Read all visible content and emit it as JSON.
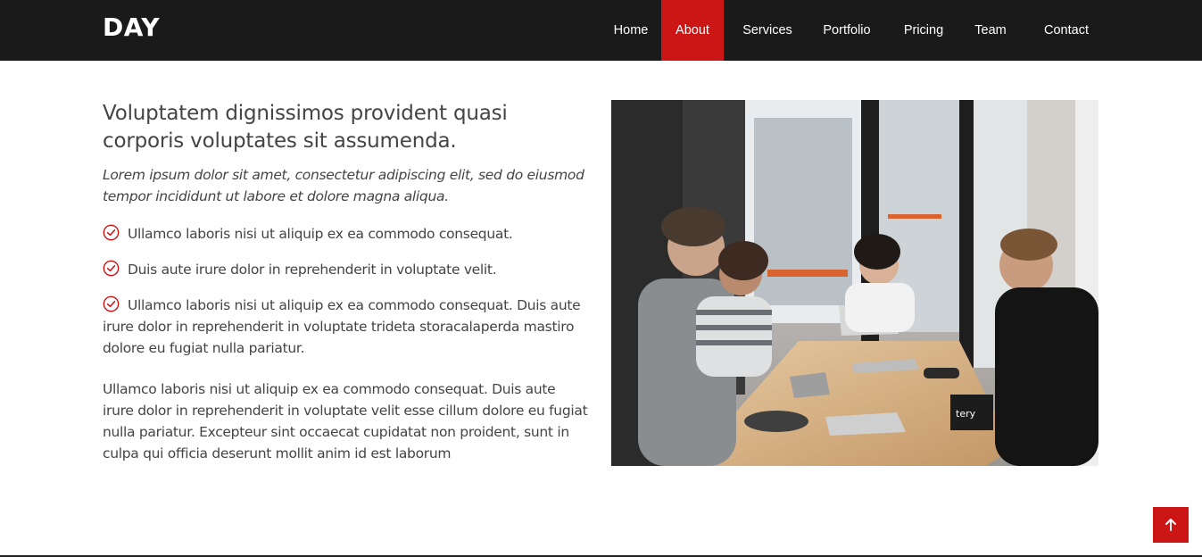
{
  "brand": {
    "logo": "DAY"
  },
  "nav": {
    "items": [
      {
        "label": "Home",
        "active": false
      },
      {
        "label": "About",
        "active": true
      },
      {
        "label": "Services",
        "active": false
      },
      {
        "label": "Portfolio",
        "active": false
      },
      {
        "label": "Pricing",
        "active": false
      },
      {
        "label": "Team",
        "active": false
      },
      {
        "label": "Contact",
        "active": false
      }
    ]
  },
  "about": {
    "headline": "Voluptatem dignissimos provident quasi corporis voluptates sit assumenda.",
    "intro": "Lorem ipsum dolor sit amet, consectetur adipiscing elit, sed do eiusmod tempor incididunt ut labore et dolore magna aliqua.",
    "checklist": [
      "Ullamco laboris nisi ut aliquip ex ea commodo consequat.",
      "Duis aute irure dolor in reprehenderit in voluptate velit.",
      "Ullamco laboris nisi ut aliquip ex ea commodo consequat. Duis aute irure dolor in reprehenderit in voluptate trideta storacalaperda mastiro dolore eu fugiat nulla pariatur."
    ],
    "paragraph": "Ullamco laboris nisi ut aliquip ex ea commodo consequat. Duis aute irure dolor in reprehenderit in voluptate velit esse cillum dolore eu fugiat nulla pariatur. Excepteur sint occaecat cupidatat non proident, sunt in culpa qui officia deserunt mollit anim id est laborum",
    "photo_text": "tery"
  },
  "icons": {
    "check": "check-circle-icon",
    "back_to_top": "arrow-up-icon"
  },
  "colors": {
    "accent": "#cc1616",
    "header_bg": "#1a1a1a",
    "text": "#444444"
  }
}
